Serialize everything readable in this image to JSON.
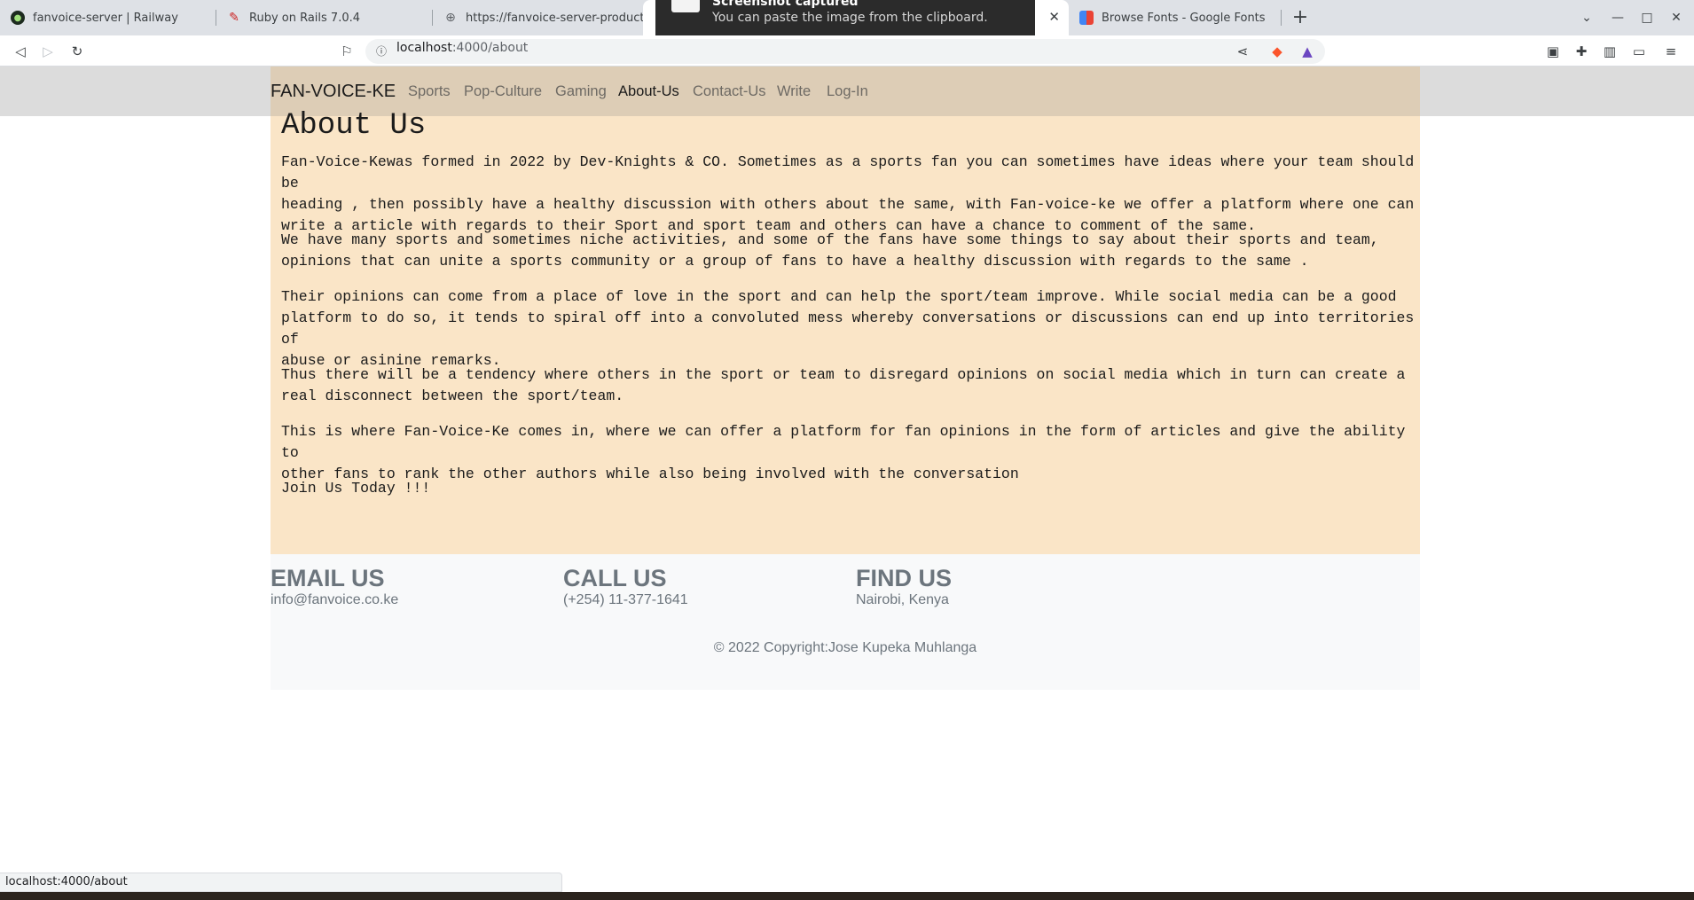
{
  "browser": {
    "tabs": [
      {
        "title": "fanvoice-server | Railway",
        "icon": "railway-icon"
      },
      {
        "title": "Ruby on Rails 7.0.4",
        "icon": "rails-icon"
      },
      {
        "title": "https://fanvoice-server-productio",
        "icon": "globe-icon"
      },
      {
        "title": "",
        "icon": "globe-icon",
        "active": true
      },
      {
        "title": "Browse Fonts - Google Fonts",
        "icon": "google-fonts-icon"
      }
    ],
    "url_host": "localhost",
    "url_path": ":4000/about",
    "status_url": "localhost:4000/about"
  },
  "notification": {
    "title": "Screenshot captured",
    "body": "You can paste the image from the clipboard."
  },
  "nav": {
    "brand": "FAN-VOICE-KE",
    "links": [
      "Sports",
      "Pop-Culture",
      "Gaming",
      "About-Us",
      "Contact-Us",
      "Write",
      "Log-In"
    ],
    "active": "About-Us"
  },
  "about": {
    "title": "About Us",
    "paragraphs": [
      [
        "Fan-Voice-Kewas formed in 2022 by Dev-Knights & CO. Sometimes as a sports fan you can sometimes have ideas where your team should be",
        "heading , then possibly have a healthy discussion with others about the same, with Fan-voice-ke we offer a platform where one can",
        "write a article with regards to their Sport and sport team and others can have a chance to comment of the same."
      ],
      [
        "We have many sports and sometimes niche activities, and some of the fans have some things to say about their sports and team,",
        "opinions that can unite a sports community or a group of fans to have a healthy discussion with regards to the same ."
      ],
      [
        "Their opinions can come from a place of love in the sport and can help the sport/team improve. While social media can be a good",
        "platform to do so, it tends to spiral off into a convoluted mess whereby conversations or discussions can end up into territories of",
        "abuse or asinine remarks."
      ],
      [
        "Thus there will be a tendency where others in the sport or team to disregard opinions on social media which in turn can create a",
        "real disconnect between the sport/team."
      ],
      [
        "This is where Fan-Voice-Ke comes in, where we can offer a platform for fan opinions in the form of articles and give the ability to",
        "other fans to rank the other authors while also being involved with the conversation"
      ],
      [
        "Join Us Today !!!"
      ]
    ]
  },
  "footer": {
    "email_heading": "EMAIL US",
    "email": "info@fanvoice.co.ke",
    "call_heading": "CALL US",
    "phone": "(+254) 11-377-1641",
    "find_heading": "FIND US",
    "location": "Nairobi, Kenya",
    "copyright": "© 2022 Copyright:Jose Kupeka Muhlanga"
  },
  "colors": {
    "content_bg": "#fae5c7",
    "navbar_bg": "#dcdcdc",
    "footer_bg": "#f8f9fa",
    "footer_text": "#6c757d"
  }
}
